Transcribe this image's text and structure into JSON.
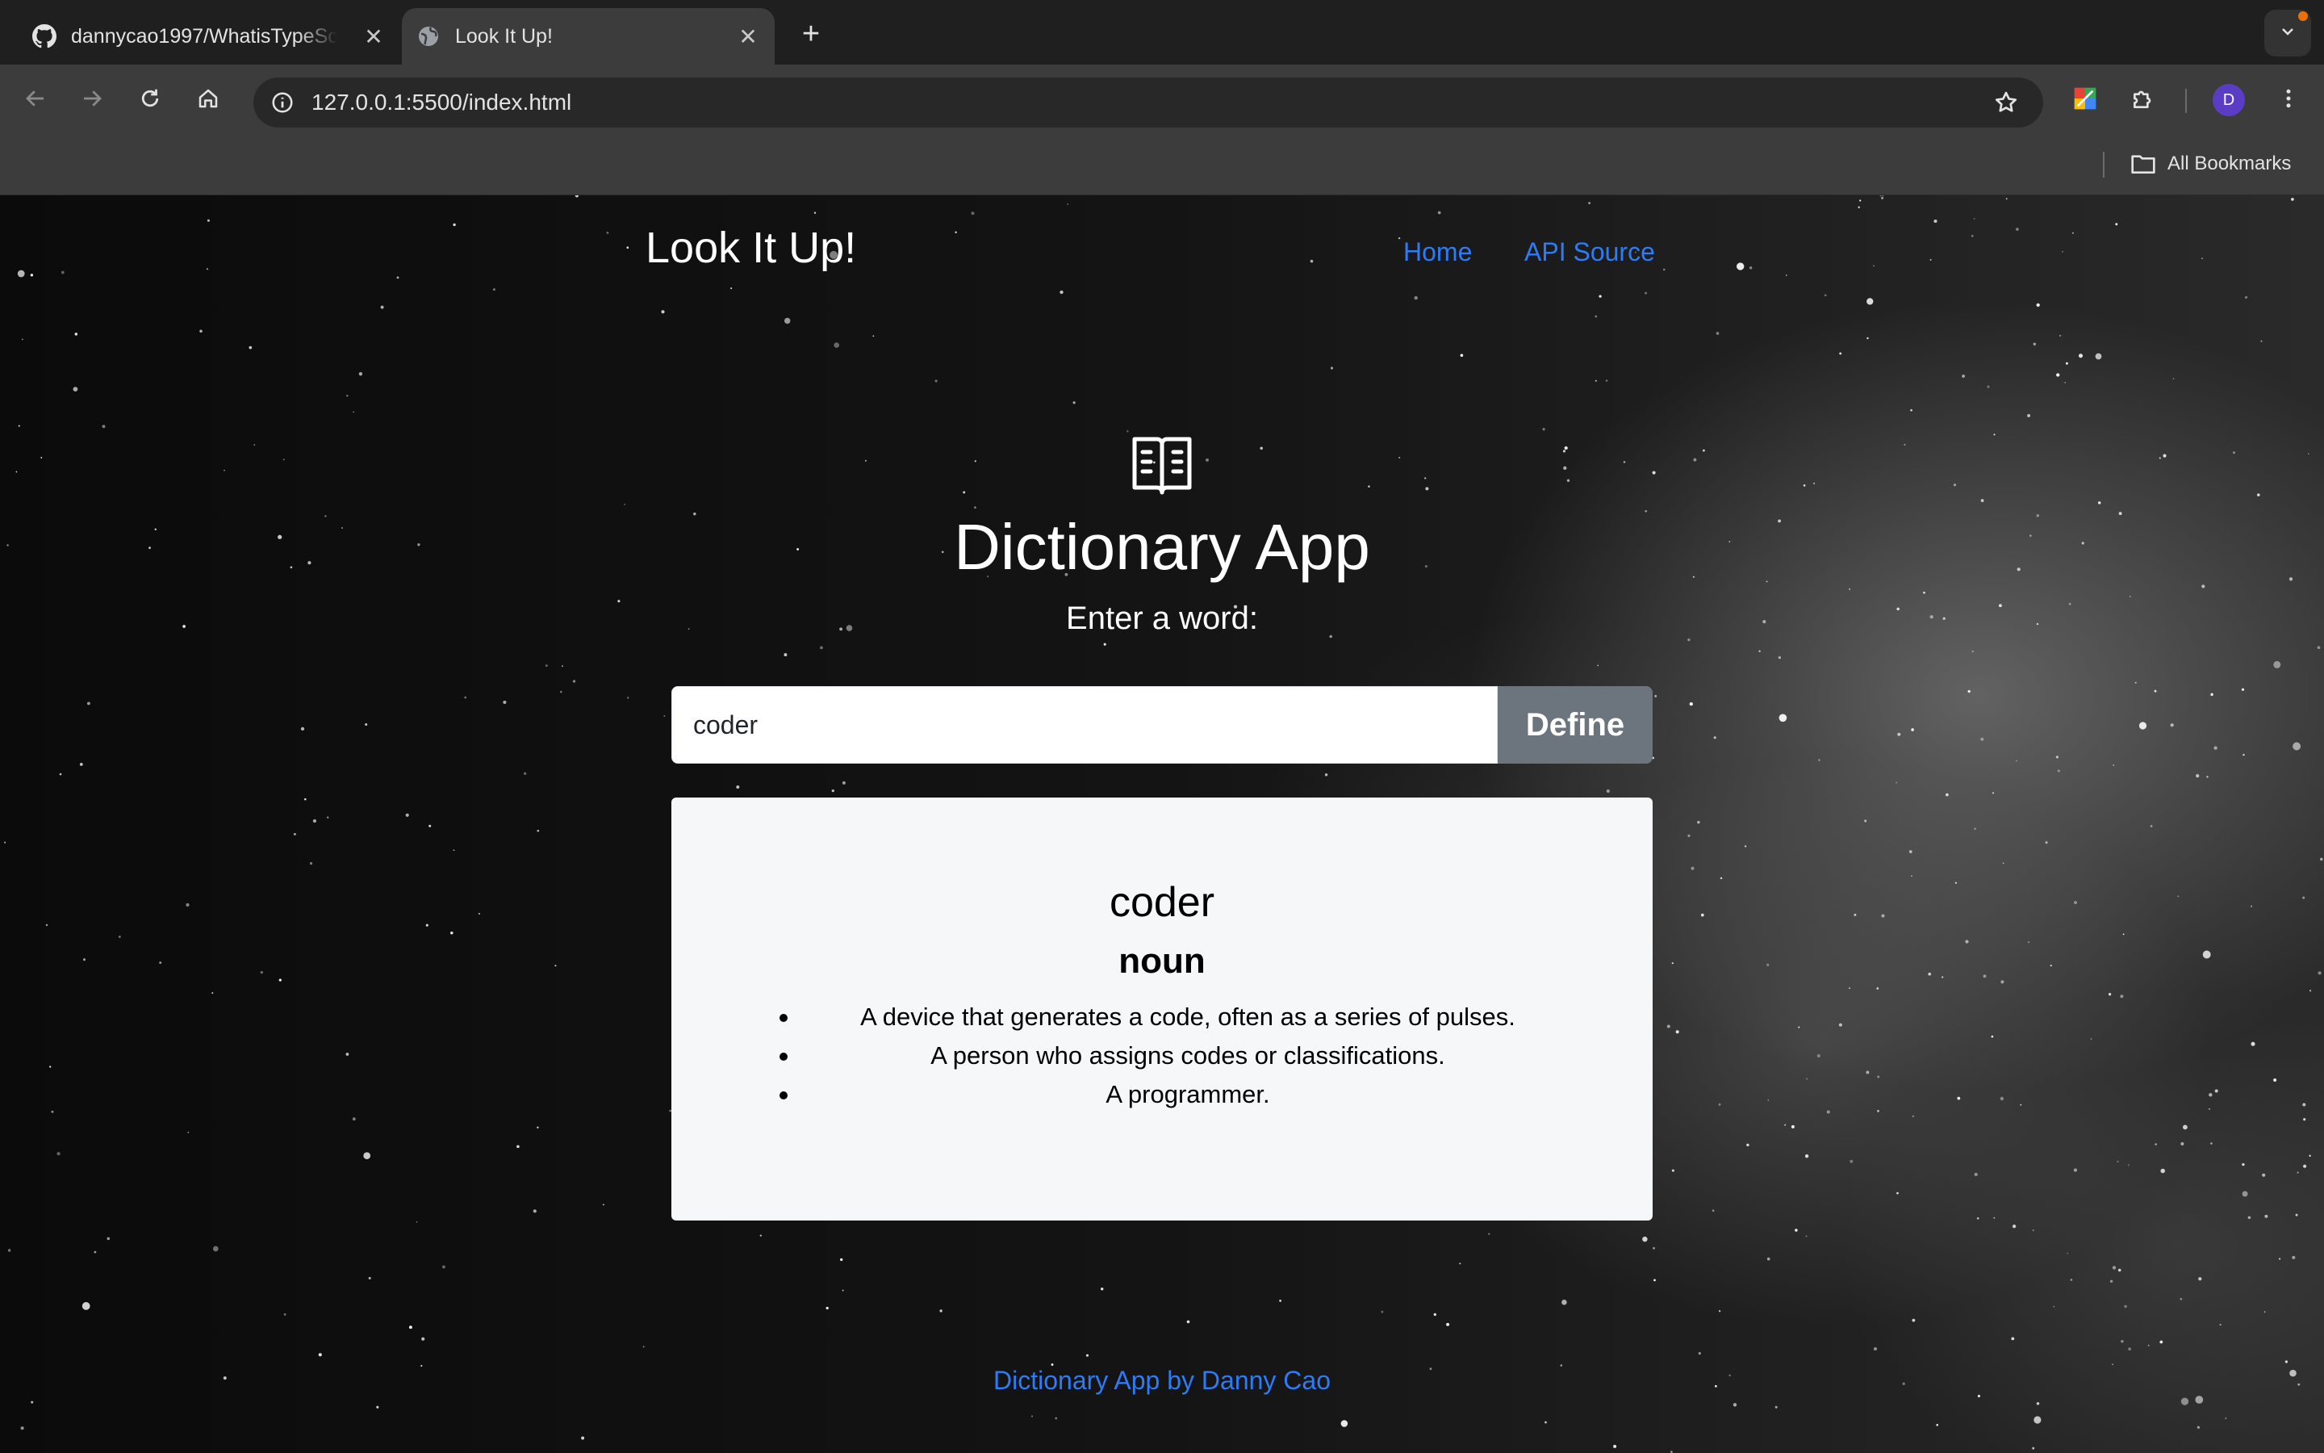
{
  "browser": {
    "tabs": [
      {
        "title": "dannycao1997/WhatisTypeScript",
        "icon": "github-icon",
        "active": false
      },
      {
        "title": "Look It Up!",
        "icon": "globe-icon",
        "active": true
      }
    ],
    "url": "127.0.0.1:5500/index.html",
    "profile_initial": "D",
    "bookmarks_label": "All Bookmarks"
  },
  "page": {
    "brand": "Look It Up!",
    "nav": [
      {
        "label": "Home"
      },
      {
        "label": "API Source"
      }
    ],
    "hero": {
      "icon": "book-icon",
      "title": "Dictionary App",
      "subtitle": "Enter a word:"
    },
    "search": {
      "value": "coder",
      "button_label": "Define"
    },
    "result": {
      "word": "coder",
      "part_of_speech": "noun",
      "definitions": [
        "A device that generates a code, often as a series of pulses.",
        "A person who assigns codes or classifications.",
        "A programmer."
      ]
    },
    "footer": "Dictionary App by Danny Cao",
    "colors": {
      "link": "#2d7cf6",
      "button": "#6c757d",
      "card": "#f6f7f9"
    }
  }
}
